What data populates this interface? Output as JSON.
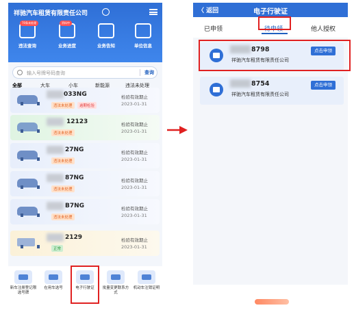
{
  "left_screen": {
    "header": {
      "title": "祥驰汽车租赁有限责任公司"
    },
    "quick_actions": [
      {
        "label": "违法查询",
        "badge": "70条未处理",
        "icon": "violation-search-icon"
      },
      {
        "label": "业务进度",
        "badge": "资料中",
        "icon": "progress-icon"
      },
      {
        "label": "业务告知",
        "badge": "",
        "icon": "notice-icon"
      },
      {
        "label": "单位信息",
        "badge": "",
        "icon": "company-info-icon"
      }
    ],
    "search": {
      "placeholder": "输入号牌号码查询",
      "button": "查询"
    },
    "categories": [
      "全部",
      "大车",
      "小车",
      "新能源",
      "违法未处理"
    ],
    "vehicles": [
      {
        "plate": "033NG",
        "tags": [
          "违法未处理",
          "逾期检验"
        ],
        "status": "检验有效期止",
        "date": "2023-01-31"
      },
      {
        "plate": "12123",
        "tags": [
          "违法未处理"
        ],
        "status": "检验有效期止",
        "date": "2023-01-31"
      },
      {
        "plate": "27NG",
        "tags": [
          "违法未处理"
        ],
        "status": "检验有效期止",
        "date": "2023-01-31"
      },
      {
        "plate": "87NG",
        "tags": [
          "违法未处理"
        ],
        "status": "检验有效期止",
        "date": "2023-01-31"
      },
      {
        "plate": "B7NG",
        "tags": [
          "违法未处理"
        ],
        "status": "检验有效期止",
        "date": "2023-01-31"
      },
      {
        "plate": "2129",
        "tags": [
          "正常"
        ],
        "status": "检验有效期止",
        "date": "2023-01-31"
      }
    ],
    "bottom_services": [
      {
        "label": "新车注册登记限选号牌"
      },
      {
        "label": "在用车选号"
      },
      {
        "label": "电子行驶证"
      },
      {
        "label": "批量变更联系方式"
      },
      {
        "label": "机动车注销证明"
      }
    ]
  },
  "right_screen": {
    "header": {
      "back": "〈 返回",
      "title": "电子行驶证"
    },
    "tabs": [
      "已申领",
      "待申领",
      "他人授权"
    ],
    "cards": [
      {
        "plate": "8798",
        "company": "祥驰汽车租赁有限责任公司",
        "button": "点击申领"
      },
      {
        "plate": "8754",
        "company": "祥驰汽车租赁有限责任公司",
        "button": "点击申领"
      }
    ]
  },
  "colors": {
    "primary": "#2f6fd6",
    "highlight": "#e02020"
  }
}
